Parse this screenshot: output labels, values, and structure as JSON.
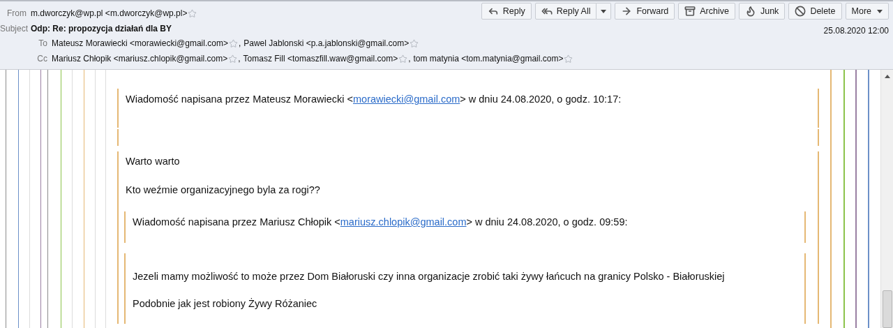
{
  "header": {
    "from": {
      "label": "From",
      "value": "m.dworczyk@wp.pl <m.dworczyk@wp.pl>"
    },
    "subject": {
      "label": "Subject",
      "value": "Odp: Re: propozycja działań dla BY"
    },
    "date": "25.08.2020 12:00",
    "to": {
      "label": "To",
      "separator": ",",
      "recipients": [
        "Mateusz Morawiecki <morawiecki@gmail.com>",
        "Pawel Jablonski <p.a.jablonski@gmail.com>"
      ]
    },
    "cc": {
      "label": "Cc",
      "separator": ",",
      "recipients": [
        "Mariusz Chłopik <mariusz.chlopik@gmail.com>",
        "Tomasz Fill <tomaszfill.waw@gmail.com>",
        "tom matynia <tom.matynia@gmail.com>"
      ]
    },
    "toolbar": [
      {
        "kind": "reply",
        "label": "Reply"
      },
      {
        "kind": "reply_all",
        "label": "Reply All"
      },
      {
        "kind": "forward",
        "label": "Forward"
      },
      {
        "kind": "archive",
        "label": "Archive"
      },
      {
        "kind": "junk",
        "label": "Junk"
      },
      {
        "kind": "delete",
        "label": "Delete"
      },
      {
        "kind": "more",
        "label": "More"
      }
    ]
  },
  "message": {
    "quote": {
      "attribution": {
        "before": "Wiadomość napisana przez Mateusz Morawiecki <",
        "link": "morawiecki@gmail.com",
        "after": "> w dniu 24.08.2020, o godz. 10:17:"
      },
      "paragraphs": [
        "Warto warto",
        "Kto weźmie organizacyjnego byla za rogi??"
      ],
      "quote": {
        "attribution": {
          "before": "Wiadomość napisana przez Mariusz Chłopik <",
          "link": "mariusz.chlopik@gmail.com",
          "after": "> w dniu 24.08.2020, o godz. 09:59:"
        },
        "paragraphs": [
          "Jezeli mamy możliwość to może przez Dom Białoruski czy inna organizacje zrobić taki żywy łańcuch na granicy Polsko - Białoruskiej",
          "Podobnie jak jest robiony Żywy Różaniec"
        ]
      }
    }
  }
}
